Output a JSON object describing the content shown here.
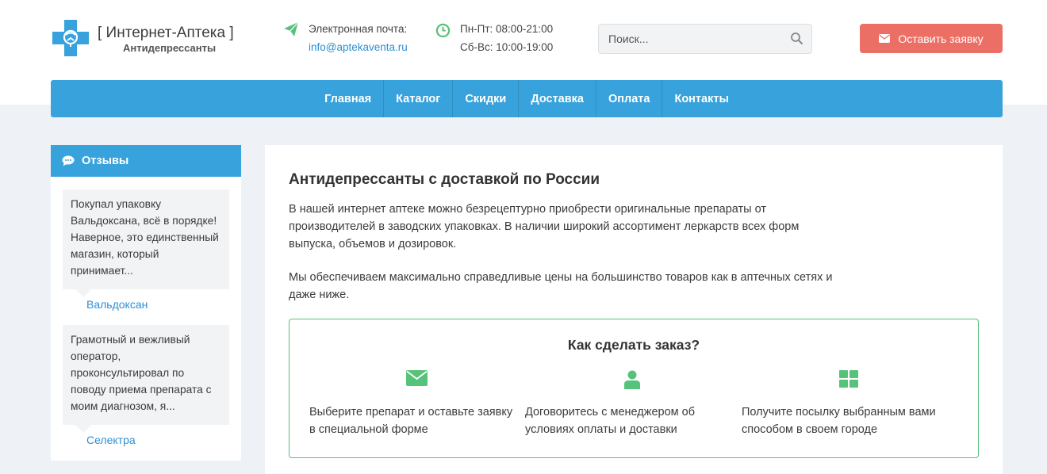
{
  "brand": {
    "title": "[ Интернет-Аптека ]",
    "subtitle": "Антидепрессанты",
    "accent_color": "#37a2dc"
  },
  "contact": {
    "email_label": "Электронная почта:",
    "email": "info@aptekaventa.ru",
    "hours_weekday": "Пн-Пт: 08:00-21:00",
    "hours_weekend": "Сб-Вс: 10:00-19:00",
    "icon_color": "#57c27a"
  },
  "search": {
    "placeholder": "Поиск...",
    "icon": "search-icon"
  },
  "cta": {
    "label": "Оставить заявку",
    "icon": "envelope-icon",
    "color": "#ec6f65"
  },
  "nav": {
    "items": [
      "Главная",
      "Каталог",
      "Скидки",
      "Доставка",
      "Оплата",
      "Контакты"
    ]
  },
  "sidebar": {
    "title": "Отзывы",
    "icon": "chat-icon",
    "reviews": [
      {
        "text": "Покупал упаковку Вальдоксана, всё в порядке! Наверное, это единственный магазин, который принимает...",
        "product": "Вальдоксан"
      },
      {
        "text": "Грамотный и вежливый оператор, проконсультировал по поводу приема препарата с моим диагнозом, я...",
        "product": "Селектра"
      }
    ]
  },
  "main": {
    "title": "Антидепрессанты с доставкой по России",
    "paragraph1": "В нашей интернет аптеке можно безрецептурно приобрести оригинальные препараты от производителей в заводских упаковках. В наличии широкий ассортимент леркарств всех форм выпуска, объемов и дозировок.",
    "paragraph2": "Мы обеспечиваем максимально справедливые цены на большинство товаров как в аптечных сетях и даже ниже.",
    "howto": {
      "title": "Как сделать заказ?",
      "border_color": "#57c27a",
      "steps": [
        {
          "icon": "envelope-icon",
          "text": "Выберите препарат и оставьте заявку в специальной форме"
        },
        {
          "icon": "user-icon",
          "text": "Договоритесь с менеджером об условиях оплаты и доставки"
        },
        {
          "icon": "grid-icon",
          "text": "Получите посылку выбранным вами способом в своем городе"
        }
      ]
    }
  }
}
